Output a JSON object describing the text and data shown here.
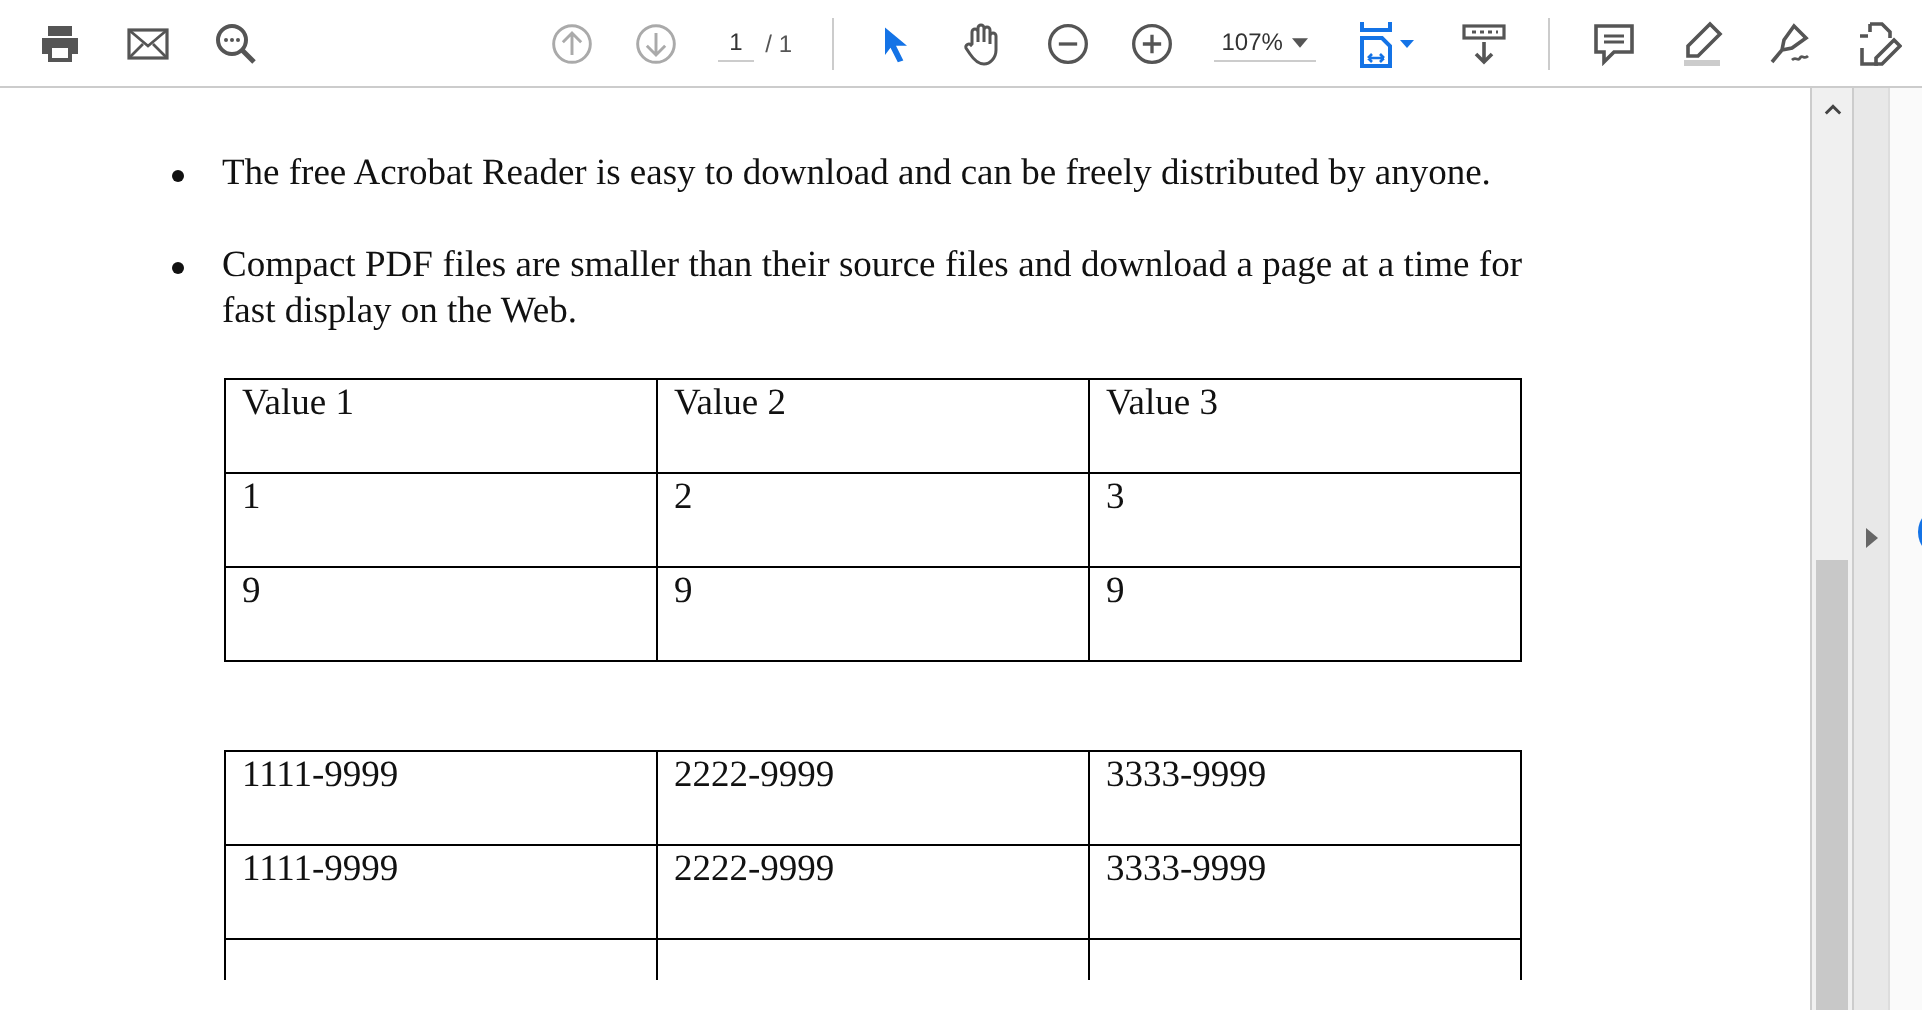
{
  "toolbar": {
    "page_current": "1",
    "page_total": "/ 1",
    "zoom": "107%",
    "tools": [
      {
        "kind": "select",
        "selected": true
      },
      {
        "kind": "hand",
        "selected": false
      }
    ]
  },
  "document": {
    "bullets": [
      "The free Acrobat Reader is easy to download and can be freely distributed by anyone.",
      "Compact PDF files are smaller than their source files and download a page at a time for fast display on the Web."
    ],
    "tables": [
      {
        "rows": [
          [
            "Value 1",
            "Value 2",
            "Value 3"
          ],
          [
            "1",
            "2",
            "3"
          ],
          [
            "9",
            "9",
            "9"
          ]
        ]
      },
      {
        "rows": [
          [
            "1111-9999",
            "2222-9999",
            "3333-9999"
          ],
          [
            "1111-9999",
            "2222-9999",
            "3333-9999"
          ]
        ],
        "cut_row": true
      }
    ]
  }
}
